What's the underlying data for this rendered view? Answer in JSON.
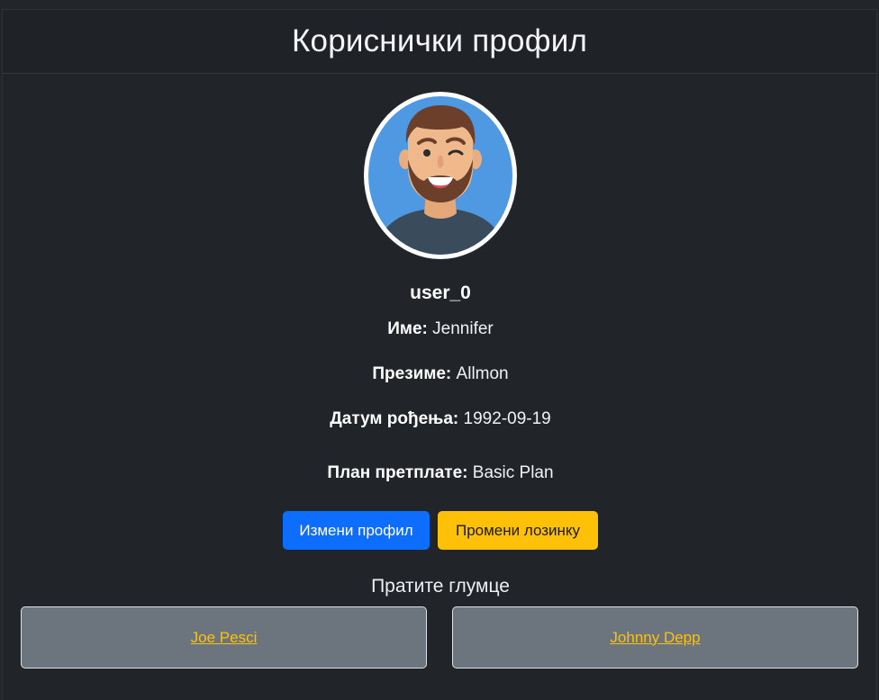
{
  "header": {
    "title": "Кориснички профил"
  },
  "profile": {
    "avatar_icon": "avatar-icon",
    "username": "user_0",
    "first_name_label": "Име:",
    "first_name": "Jennifer",
    "last_name_label": "Презиме:",
    "last_name": "Allmon",
    "birth_date_label": "Датум рођења:",
    "birth_date": "1992-09-19",
    "plan_label": "План претплате:",
    "plan": "Basic Plan"
  },
  "actions": {
    "edit_profile": "Измени профил",
    "change_password": "Промени лозинку"
  },
  "followed": {
    "title": "Пратите глумце",
    "actors": [
      "Joe Pesci",
      "Johnny Depp"
    ]
  },
  "colors": {
    "background": "#212529",
    "primary": "#0d6efd",
    "warning": "#ffc107",
    "actor_card": "#6c757d"
  }
}
